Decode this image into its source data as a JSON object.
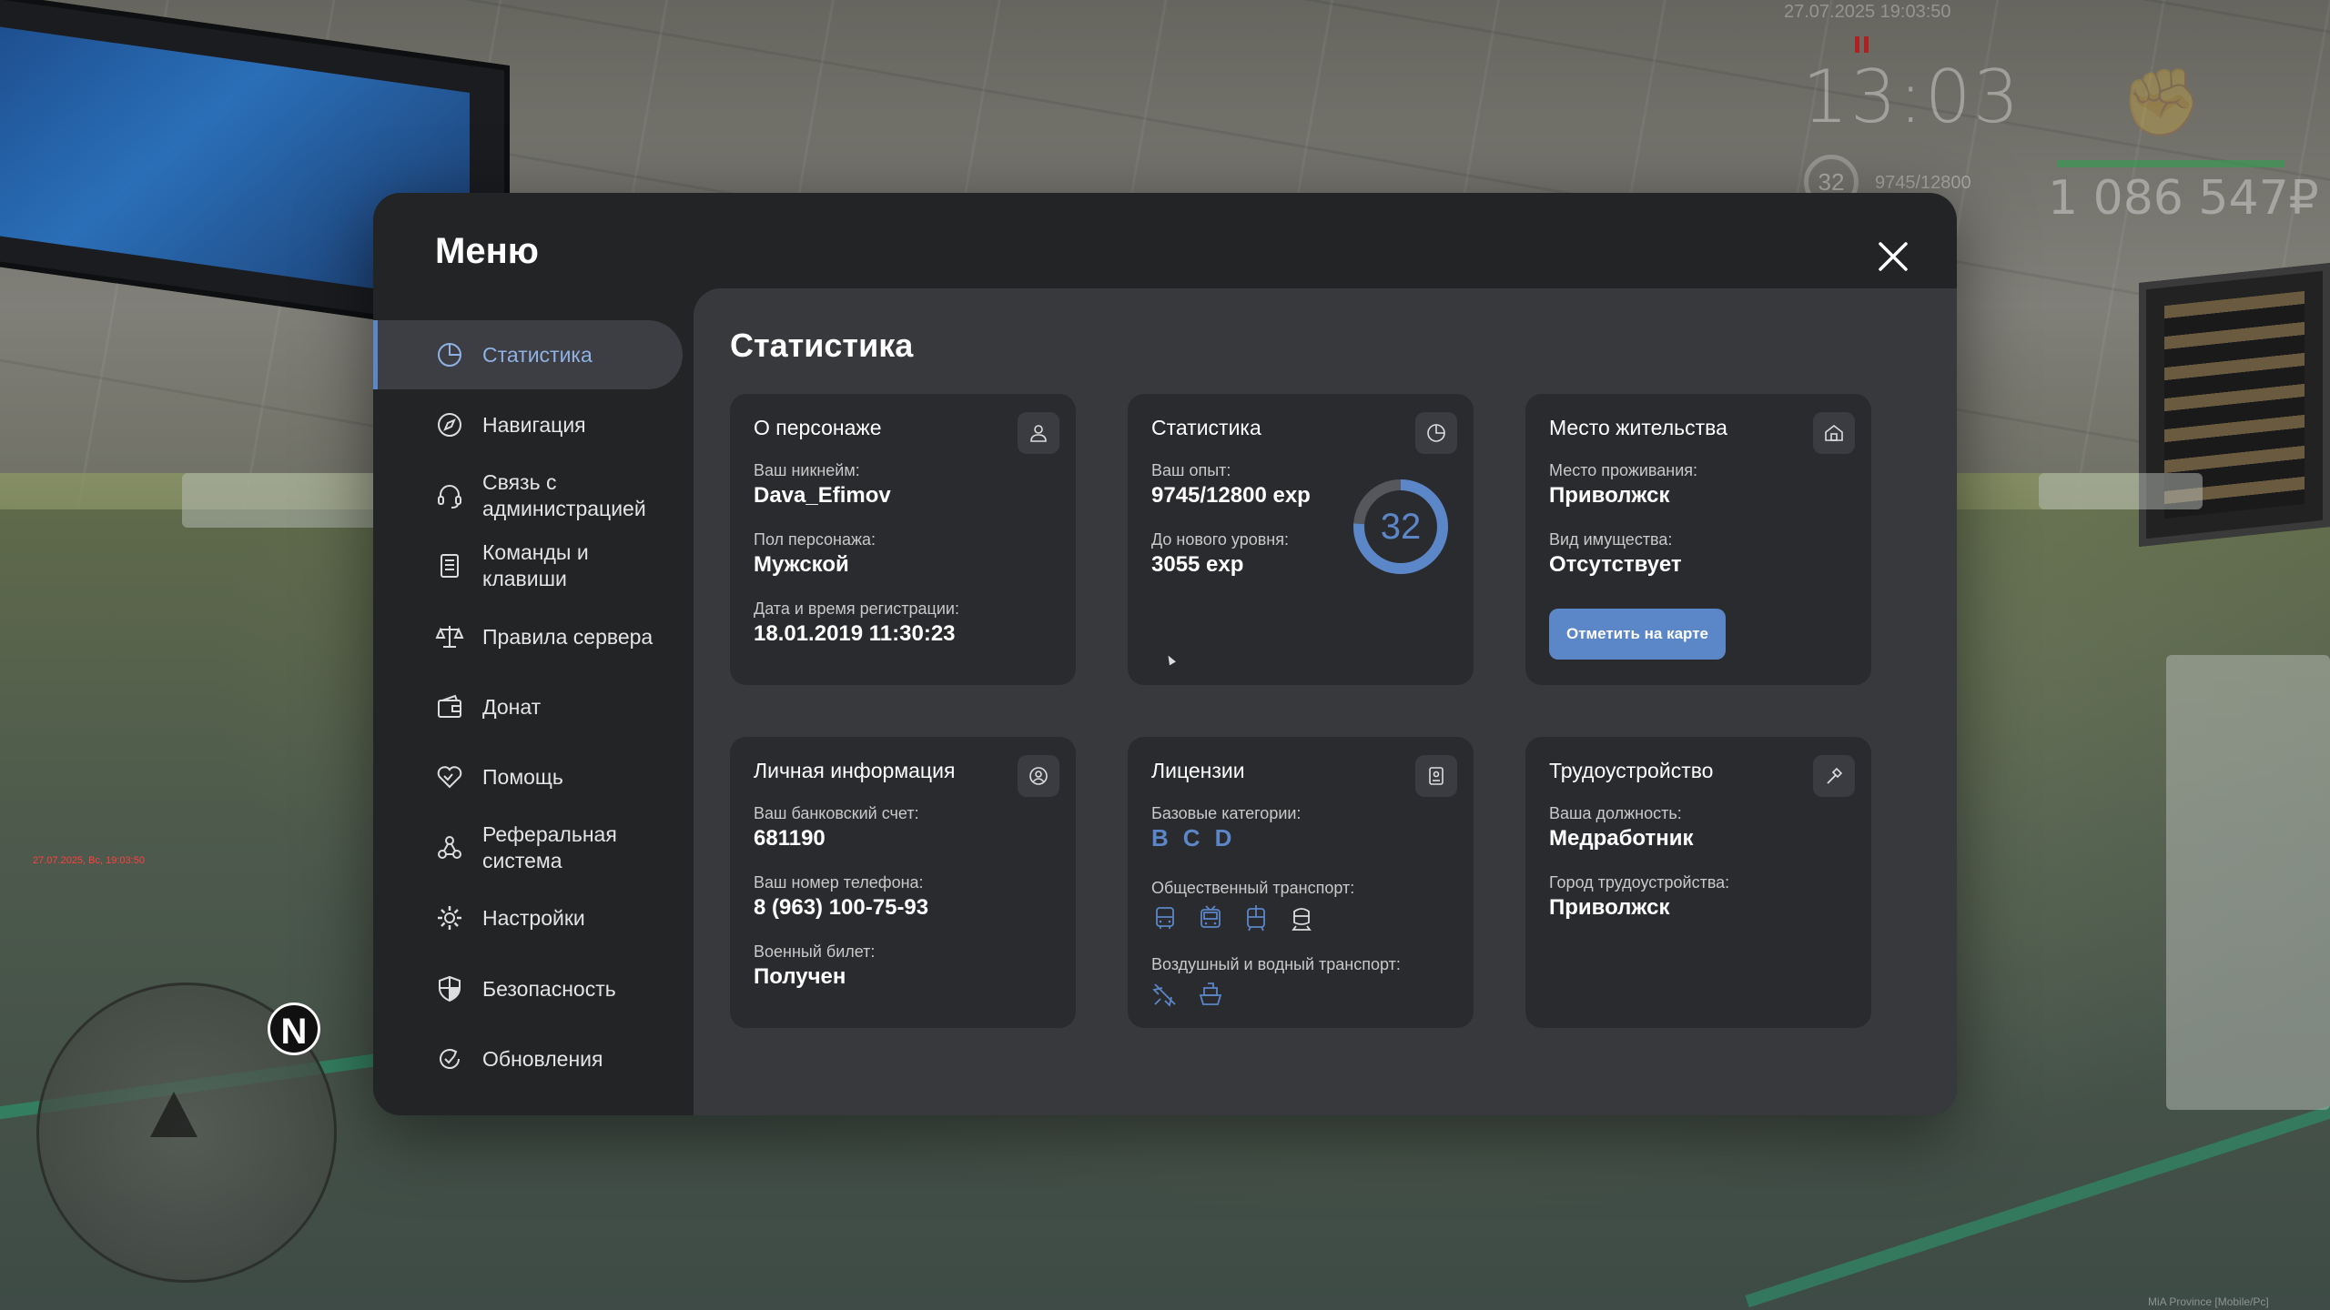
{
  "hud": {
    "date_time": "27.07.2025 19:03:50",
    "clock": "13:03",
    "level": "32",
    "exp": "9745/12800",
    "money": "1 086 547₽",
    "side_stamp": "27.07.2025, Вс, 19:03:50",
    "compass": "N",
    "corner_stamp": "MiA Province [Mobile/Pc]"
  },
  "menu": {
    "title": "Меню",
    "close_icon": "close-icon"
  },
  "sidebar": {
    "items": [
      {
        "label": "Статистика",
        "icon": "pie-chart-icon",
        "active": true
      },
      {
        "label": "Навигация",
        "icon": "compass-icon"
      },
      {
        "label": "Связь с\nадминистрацией",
        "icon": "headset-icon"
      },
      {
        "label": "Команды и\nклавиши",
        "icon": "document-list-icon"
      },
      {
        "label": "Правила сервера",
        "icon": "scales-icon"
      },
      {
        "label": "Донат",
        "icon": "wallet-icon"
      },
      {
        "label": "Помощь",
        "icon": "heart-handshake-icon"
      },
      {
        "label": "Реферальная\nсистема",
        "icon": "referral-icon"
      },
      {
        "label": "Настройки",
        "icon": "gear-icon"
      },
      {
        "label": "Безопасность",
        "icon": "shield-icon"
      },
      {
        "label": "Обновления",
        "icon": "refresh-check-icon"
      }
    ]
  },
  "content": {
    "title": "Статистика",
    "character": {
      "title": "О персонаже",
      "icon": "user-icon",
      "nickname_label": "Ваш никнейм:",
      "nickname": "Dava_Efimov",
      "gender_label": "Пол персонажа:",
      "gender": "Мужской",
      "reg_label": "Дата и время регистрации:",
      "reg": "18.01.2019 11:30:23"
    },
    "stats": {
      "title": "Статистика",
      "icon": "clock-pie-icon",
      "exp_label": "Ваш опыт:",
      "exp": "9745/12800 exp",
      "next_label": "До нового уровня:",
      "next": "3055 exp",
      "level": "32",
      "progress": 0.76
    },
    "residence": {
      "title": "Место жительства",
      "icon": "house-icon",
      "place_label": "Место проживания:",
      "place": "Приволжск",
      "property_label": "Вид имущества:",
      "property": "Отсутствует",
      "button": "Отметить на карте"
    },
    "personal": {
      "title": "Личная информация",
      "icon": "user-circle-icon",
      "bank_label": "Ваш банковский счет:",
      "bank": "681190",
      "phone_label": "Ваш номер телефона:",
      "phone": "8 (963) 100-75-93",
      "military_label": "Военный билет:",
      "military": "Получен"
    },
    "licenses": {
      "title": "Лицензии",
      "icon": "id-badge-icon",
      "base_label": "Базовые категории:",
      "base": [
        "B",
        "C",
        "D"
      ],
      "public_label": "Общественный транспорт:",
      "public_icons": [
        "bus-icon",
        "trolleybus-icon",
        "tram-icon",
        "train-icon"
      ],
      "air_label": "Воздушный и водный транспорт:",
      "air_icons": [
        "plane-icon",
        "ship-icon"
      ]
    },
    "job": {
      "title": "Трудоустройство",
      "icon": "hammer-icon",
      "position_label": "Ваша должность:",
      "position": "Медработник",
      "city_label": "Город трудоустройства:",
      "city": "Приволжск"
    }
  },
  "colors": {
    "accent": "#5b86c8",
    "panel": "#232426",
    "content": "#38393d",
    "card": "#2a2b2e"
  }
}
